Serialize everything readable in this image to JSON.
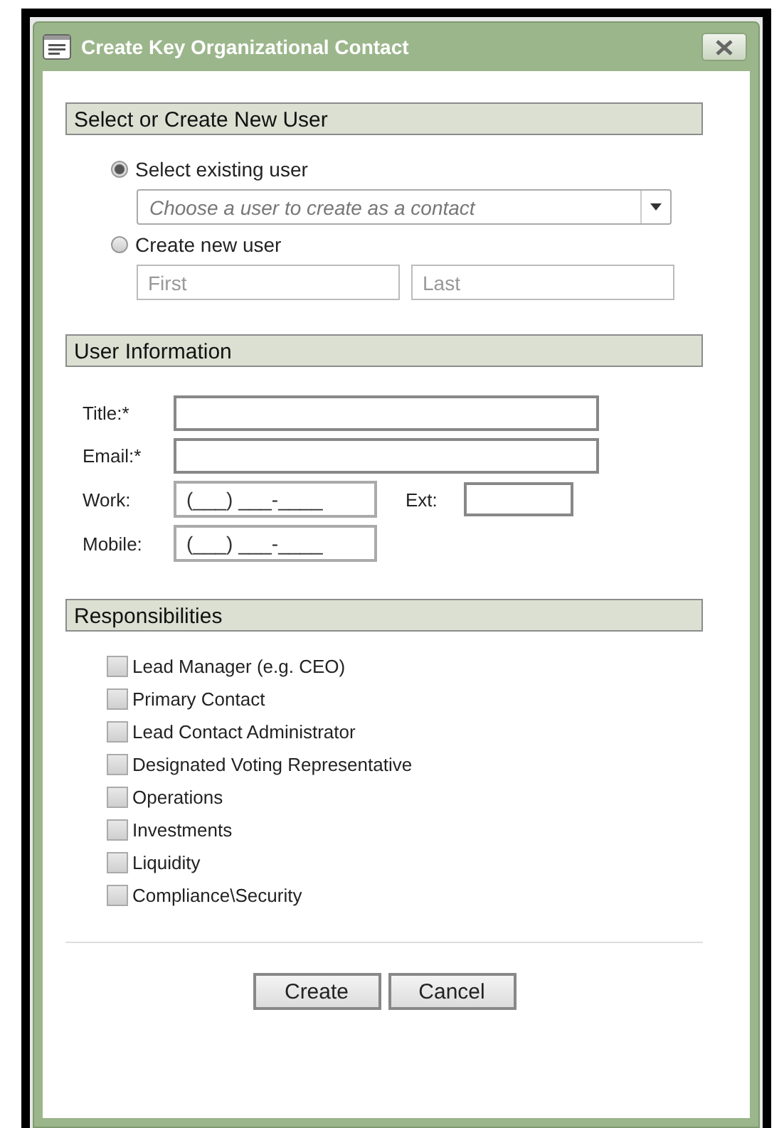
{
  "window": {
    "title": "Create Key Organizational Contact"
  },
  "user_section": {
    "heading": "Select or Create New User",
    "options": [
      {
        "label": "Select existing user",
        "selected": true
      },
      {
        "label": "Create new user",
        "selected": false
      }
    ],
    "user_select": {
      "placeholder": "Choose a user to create as a contact"
    },
    "first_name": {
      "placeholder": "First"
    },
    "last_name": {
      "placeholder": "Last"
    }
  },
  "info_section": {
    "heading": "User Information",
    "title_field": {
      "label": "Title:*"
    },
    "email_field": {
      "label": "Email:*"
    },
    "work_field": {
      "label": "Work:",
      "value": "(___) ___-____"
    },
    "ext_field": {
      "label": "Ext:"
    },
    "mobile_field": {
      "label": "Mobile:",
      "value": "(___) ___-____"
    }
  },
  "responsibilities": {
    "heading": "Responsibilities",
    "items": [
      {
        "label": "Lead Manager (e.g. CEO)",
        "checked": false
      },
      {
        "label": "Primary Contact",
        "checked": false
      },
      {
        "label": "Lead Contact Administrator",
        "checked": false
      },
      {
        "label": "Designated Voting Representative",
        "checked": false
      },
      {
        "label": "Operations",
        "checked": false
      },
      {
        "label": "Investments",
        "checked": false
      },
      {
        "label": "Liquidity",
        "checked": false
      },
      {
        "label": "Compliance\\Security",
        "checked": false
      }
    ]
  },
  "buttons": [
    {
      "label": "Create"
    },
    {
      "label": "Cancel"
    }
  ]
}
